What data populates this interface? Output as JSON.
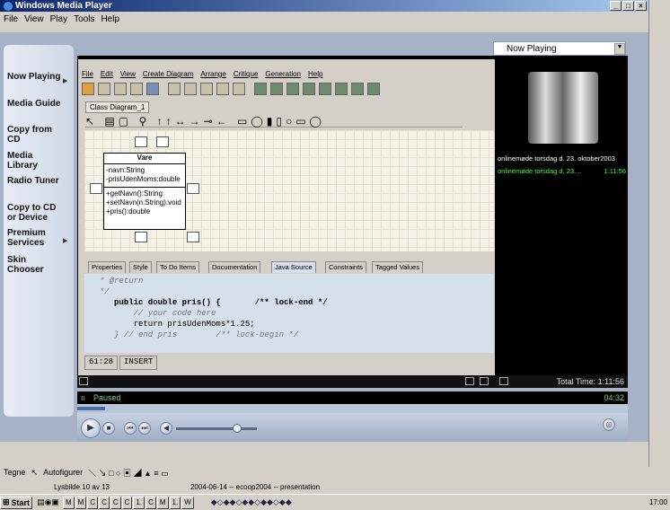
{
  "window": {
    "title": "Windows Media Player",
    "menu": [
      "File",
      "View",
      "Play",
      "Tools",
      "Help"
    ]
  },
  "sidebar": {
    "items": [
      {
        "label": "Now Playing",
        "has_arrow": true
      },
      {
        "label": "Media Guide",
        "has_arrow": false
      },
      {
        "label": "Copy from CD",
        "has_arrow": false
      },
      {
        "label": "Media Library",
        "has_arrow": false
      },
      {
        "label": "Radio Tuner",
        "has_arrow": false
      },
      {
        "label": "Copy to CD or Device",
        "has_arrow": false
      },
      {
        "label": "Premium Services",
        "has_arrow": true
      },
      {
        "label": "Skin Chooser",
        "has_arrow": false
      }
    ]
  },
  "nowplaying_dropdown": "Now Playing",
  "app": {
    "menu": [
      "File",
      "Edit",
      "View",
      "Create Diagram",
      "Arrange",
      "Critique",
      "Generation",
      "Help"
    ],
    "diagram_tab": "Class Diagram_1",
    "class": {
      "name": "Vare",
      "attributes": [
        "-navn:String",
        "-prisUdenMoms:double"
      ],
      "operations": [
        "+getNavn():String",
        "+setNavn(n:String):void",
        "+pris():double"
      ]
    },
    "tabs": [
      "Properties",
      "Style",
      "To Do Items",
      "Documentation",
      "Java Source",
      "Constraints",
      "Tagged Values"
    ],
    "active_tab": "Java Source",
    "code_lines": [
      "  * @return",
      "  */",
      "     public double pris() {       /** lock-end */",
      "         // your code here",
      "         return prisUdenMoms*1.25;",
      "     } // end pris        /** lock-begin */"
    ],
    "cursor_pos": "61:28",
    "mode": "INSERT"
  },
  "playlist": {
    "title": "onlinemøde torsdag d. 23. oktober2003",
    "item": "onlinemøde torsdag d. 23....",
    "item_time": "1:11:56",
    "total_time": "Total Time: 1:11:56"
  },
  "player": {
    "status": "Paused",
    "elapsed": "04:32",
    "progress": 0.05,
    "volume": 0.7
  },
  "powerpoint": {
    "draw_label": "Tegne",
    "autoshapes": "Autofigurer",
    "slide_info": "Lysbilde 10 av 13",
    "presentation": "2004-06-14 -- ecoop2004 -- presentation"
  },
  "taskbar": {
    "start": "Start",
    "tasks": [
      "M",
      "M",
      "C",
      "C",
      "C",
      "C",
      "1.",
      "C",
      "M",
      "1.",
      "W"
    ],
    "clock": "17:00"
  },
  "colors": {
    "titlebar": "#0a246a",
    "playlist_text": "#3fff3f",
    "wmp_body": "#a7b2c7"
  }
}
